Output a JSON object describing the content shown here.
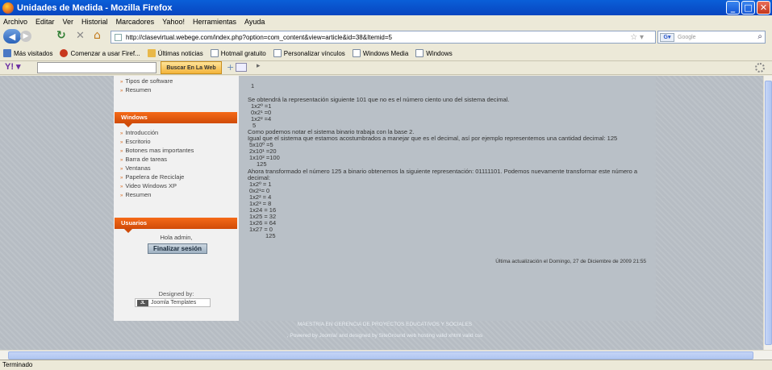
{
  "window": {
    "title": "Unidades de Medida - Mozilla Firefox"
  },
  "menubar": [
    "Archivo",
    "Editar",
    "Ver",
    "Historial",
    "Marcadores",
    "Yahoo!",
    "Herramientas",
    "Ayuda"
  ],
  "nav": {
    "url": "http://clasevirtual.webege.com/index.php?option=com_content&view=article&id=38&Itemid=5",
    "search_placeholder": "Google"
  },
  "bookmarks": [
    "Más visitados",
    "Comenzar a usar Firef...",
    "Últimas noticias",
    "Hotmail gratuito",
    "Personalizar vínculos",
    "Windows Media",
    "Windows"
  ],
  "yahoo": {
    "button": "Buscar En La Web"
  },
  "sidebar": {
    "top_items": [
      "Tipos de software",
      "Resumen"
    ],
    "windows_header": "Windows",
    "windows_items": [
      "Introducción",
      "Escritorio",
      "Botones mas importantes",
      "Barra de tareas",
      "Ventanas",
      "Papelera de Reciclaje",
      "Video Windows XP",
      "Resumen"
    ],
    "users_header": "Usuarios",
    "greeting": "Hola admin,",
    "logout": "Finalizar sesión",
    "designed_by": "Designed by:",
    "joomla_templates": "Joomla Templates"
  },
  "article": {
    "lines": [
      "1",
      "Se obtendrá la representación siguiente 101 que no es el número ciento uno del sistema decimal.",
      "1x2º =1",
      "0x2¹ =0",
      "1x2² =4",
      "5",
      "Como podemos notar el sistema binario trabaja con la base 2.",
      "Igual  que el sistema que estamos acostumbrados a manejar que es el decimal, así por ejemplo representemos una cantidad decimal: 125",
      "5x10º =5",
      "2x10¹ =20",
      "1x10² =100",
      "125",
      "Ahora transformado el número 125 a binario obtenemos la siguiente representación: 01111101. Podemos nuevamente transformar este número a",
      "decimal:",
      "1x2º = 1",
      "0x2¹= 0",
      "1x2² = 4",
      "1x2³ = 8",
      "1x24 = 16",
      "1x25 = 32",
      "1x26 = 64",
      "1x27 =  0",
      "125"
    ],
    "updated": "Última actualización el Domingo, 27 de Diciembre de 2009 21:55"
  },
  "footer": {
    "line1": "MAESTRIA EN GERENCIA DE PROYECTOS EDUCATIVOS Y SOCIALES",
    "line2": ", Powered by Joomla! and designed by SiteGround web hosting valid xhtml valid css"
  },
  "status": "Terminado"
}
